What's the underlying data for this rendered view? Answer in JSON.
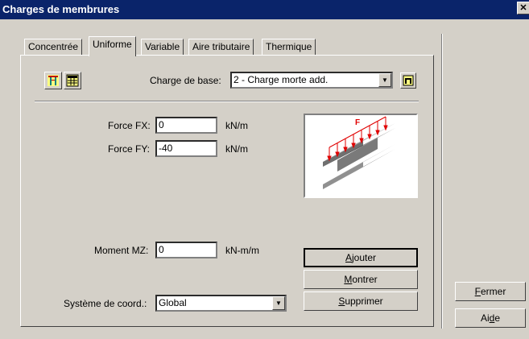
{
  "window": {
    "title": "Charges de membrures",
    "close_label": "✕"
  },
  "tabs": [
    {
      "label": "Concentrée"
    },
    {
      "label": "Uniforme"
    },
    {
      "label": "Variable"
    },
    {
      "label": "Aire tributaire"
    },
    {
      "label": "Thermique"
    }
  ],
  "base_load": {
    "label": "Charge de base:",
    "value": "2 - Charge morte add."
  },
  "forces": {
    "fx": {
      "label": "Force FX:",
      "value": "0",
      "unit": "kN/m"
    },
    "fy": {
      "label": "Force FY:",
      "value": "-40",
      "unit": "kN/m"
    },
    "mz": {
      "label": "Moment MZ:",
      "value": "0",
      "unit": "kN-m/m"
    }
  },
  "coord": {
    "label": "Système de coord.:",
    "value": "Global"
  },
  "preview": {
    "force_label": "F"
  },
  "buttons": {
    "ajouter_pre": "",
    "ajouter_key": "A",
    "ajouter_post": "jouter",
    "montrer_pre": "",
    "montrer_key": "M",
    "montrer_post": "ontrer",
    "supprimer_pre": "",
    "supprimer_key": "S",
    "supprimer_post": "upprimer",
    "fermer_pre": "",
    "fermer_key": "F",
    "fermer_post": "ermer",
    "aide_pre": "Ai",
    "aide_key": "d",
    "aide_post": "e"
  },
  "colors": {
    "titlebar": "#0a246a",
    "window_bg": "#d4d0c8",
    "load_arrows": "#e00000"
  }
}
